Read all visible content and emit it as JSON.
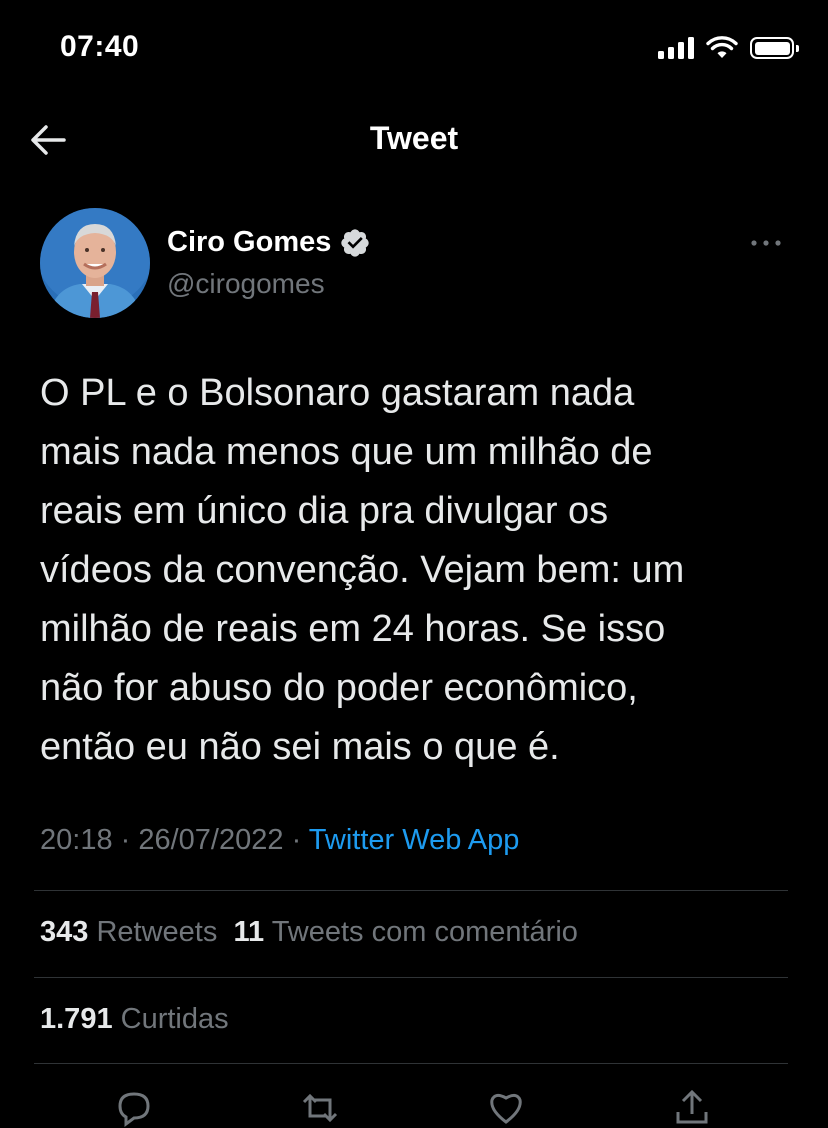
{
  "status_bar": {
    "time": "07:40"
  },
  "header": {
    "title": "Tweet"
  },
  "author": {
    "name": "Ciro Gomes",
    "handle": "@cirogomes"
  },
  "tweet": {
    "text": "O PL e o Bolsonaro gastaram nada\nmais nada menos que um milhão de\nreais em único dia pra divulgar os\nvídeos da convenção. Vejam bem: um\nmilhão de reais em 24 horas. Se isso\nnão for abuso do poder econômico,\nentão eu não sei mais o que é.",
    "time": "20:18",
    "separator1": " · ",
    "date": "26/07/2022",
    "separator2": " · ",
    "source": "Twitter Web App"
  },
  "stats": {
    "retweets_count": "343",
    "retweets_label": "Retweets",
    "quotes_count": "11",
    "quotes_label": "Tweets com comentário",
    "likes_count": "1.791",
    "likes_label": "Curtidas"
  },
  "colors": {
    "background": "#000000",
    "accent": "#1d9bf0",
    "secondary_text": "#71767b",
    "divider": "#2f3336"
  },
  "icons": [
    "back-arrow-icon",
    "verified-badge-icon",
    "more-icon",
    "reply-icon",
    "retweet-icon",
    "like-icon",
    "share-icon",
    "signal-icon",
    "wifi-icon",
    "battery-icon"
  ]
}
